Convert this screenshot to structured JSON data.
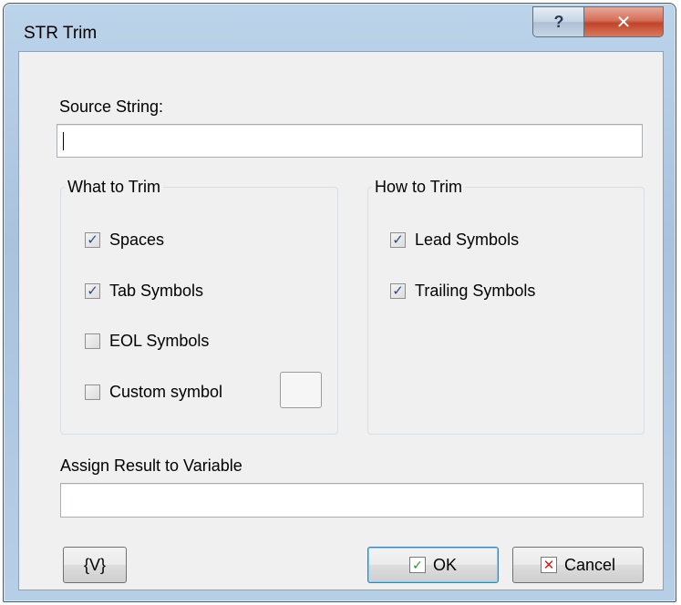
{
  "window": {
    "title": "STR Trim",
    "help_glyph": "?",
    "close_glyph": "✕"
  },
  "source": {
    "label": "Source String:",
    "value": ""
  },
  "what_group": {
    "legend": "What to Trim",
    "items": [
      {
        "label": "Spaces",
        "checked": true
      },
      {
        "label": "Tab Symbols",
        "checked": true
      },
      {
        "label": "EOL Symbols",
        "checked": false
      },
      {
        "label": "Custom symbol",
        "checked": false
      }
    ]
  },
  "how_group": {
    "legend": "How to Trim",
    "items": [
      {
        "label": "Lead Symbols",
        "checked": true
      },
      {
        "label": "Trailing Symbols",
        "checked": true
      }
    ]
  },
  "assign": {
    "label": "Assign Result to Variable",
    "value": ""
  },
  "buttons": {
    "variable": "{V}",
    "ok": "OK",
    "cancel": "Cancel"
  },
  "icons": {
    "ok": "check-icon",
    "cancel": "x-icon",
    "checkmark": "✓"
  }
}
